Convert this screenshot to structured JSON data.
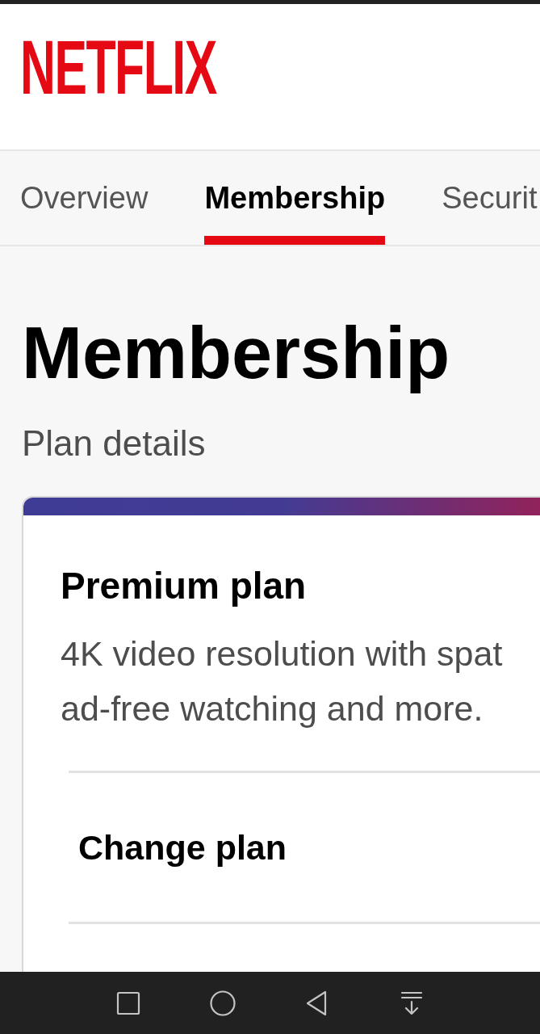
{
  "logo": "NETFLIX",
  "tabs": [
    {
      "label": "Overview",
      "selected": false
    },
    {
      "label": "Membership",
      "selected": true
    },
    {
      "label": "Securit",
      "selected": false
    }
  ],
  "page": {
    "title": "Membership",
    "subtitle": "Plan details"
  },
  "plan_card": {
    "name": "Premium plan",
    "description_lines": [
      "4K video resolution with spat",
      "ad-free watching and more."
    ],
    "actions": [
      {
        "label": "Change plan"
      }
    ]
  }
}
